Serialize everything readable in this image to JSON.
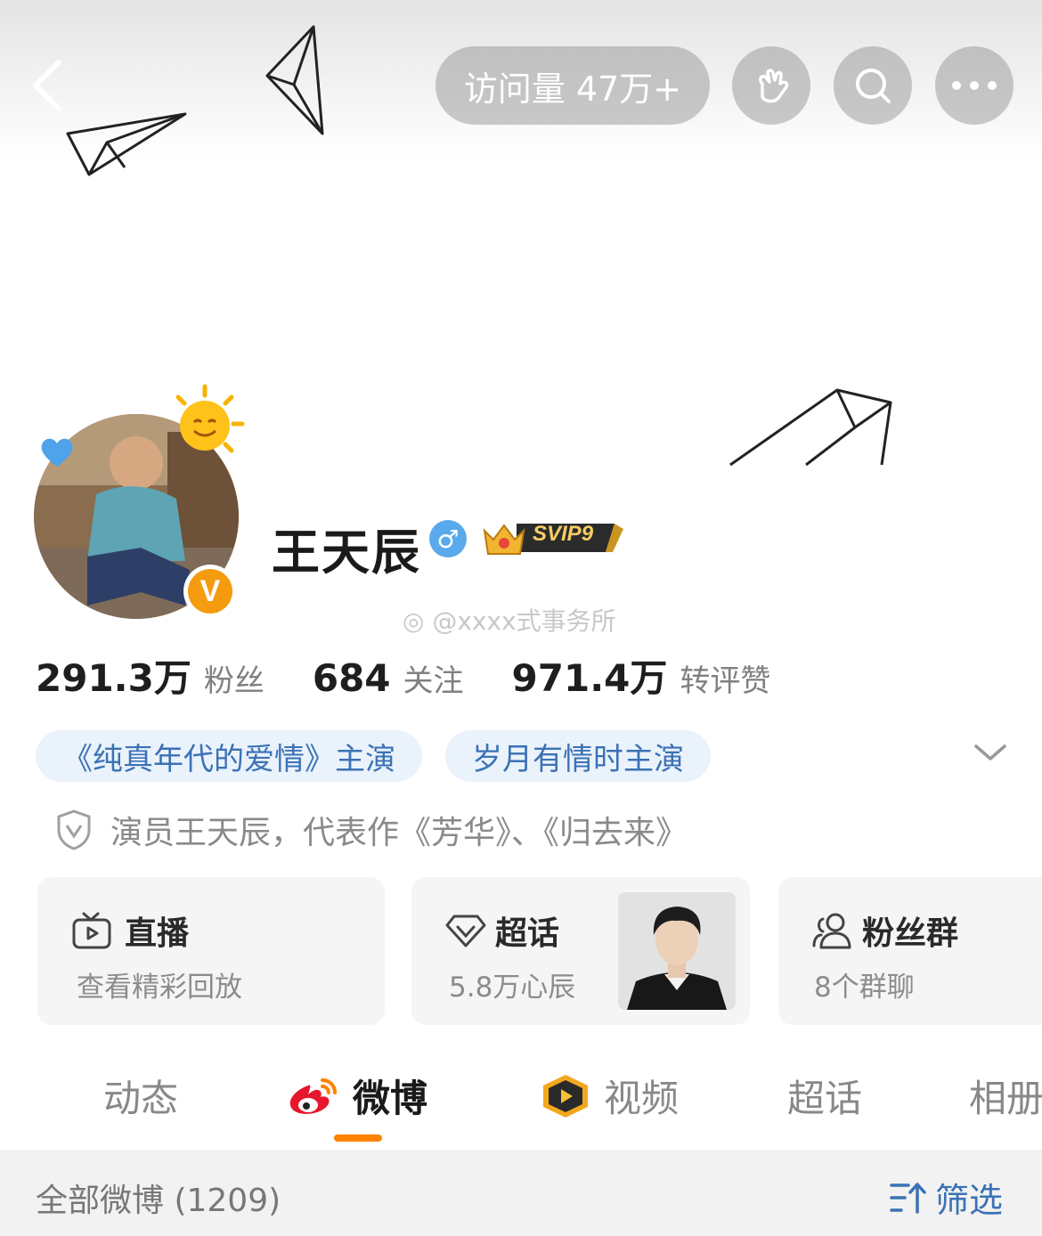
{
  "header": {
    "visits_label": "访问量 47万+",
    "icons": [
      "back-chevron-icon",
      "hand-wave-icon",
      "search-icon",
      "more-dots-icon"
    ]
  },
  "profile": {
    "name": "王天辰",
    "gender_symbol": "♂",
    "vip_badge": "SVIP9",
    "verified_badge": "V",
    "watermark": "@xxxx式事务所"
  },
  "stats": [
    {
      "value": "291.3万",
      "label": "粉丝"
    },
    {
      "value": "684",
      "label": "关注"
    },
    {
      "value": "971.4万",
      "label": "转评赞"
    }
  ],
  "tags": [
    "《纯真年代的爱情》主演",
    "岁月有情时主演"
  ],
  "verification": "演员王天辰，代表作《芳华》、《归去来》",
  "cards": {
    "live": {
      "title": "直播",
      "subtitle": "查看精彩回放"
    },
    "supertopic": {
      "title": "超话",
      "subtitle": "5.8万心辰"
    },
    "fangroup": {
      "title": "粉丝群",
      "subtitle": "8个群聊"
    }
  },
  "tabs": [
    {
      "label": "动态",
      "active": false
    },
    {
      "label": "微博",
      "active": true
    },
    {
      "label": "视频",
      "active": false
    },
    {
      "label": "超话",
      "active": false
    },
    {
      "label": "相册",
      "active": false
    }
  ],
  "filter": {
    "count_label": "全部微博 (1209)",
    "filter_label": "筛选"
  },
  "colors": {
    "accent_orange": "#ff8200",
    "link_blue": "#3b72b5",
    "tag_bg": "#eaf2fb",
    "gender_blue": "#5aa9ec",
    "verified_orange": "#f59b10"
  }
}
